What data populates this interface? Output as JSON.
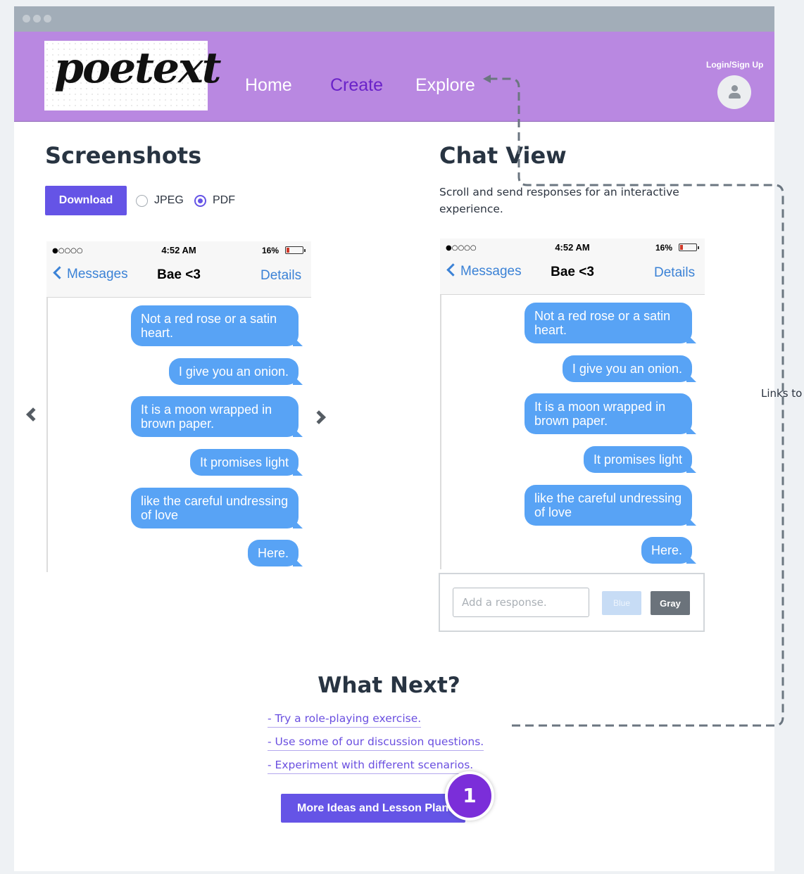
{
  "nav": {
    "logo_text": "poetext",
    "links": [
      "Home",
      "Create",
      "Explore"
    ],
    "active_link": "Create",
    "login_label": "Login/Sign Up"
  },
  "screenshots": {
    "title": "Screenshots",
    "download_label": "Download",
    "formats": [
      {
        "label": "JPEG",
        "selected": false
      },
      {
        "label": "PDF",
        "selected": true
      }
    ]
  },
  "phone": {
    "signal": "●○○○○",
    "time": "4:52 AM",
    "battery": "16%",
    "back_label": "Messages",
    "contact": "Bae <3",
    "details_label": "Details",
    "messages": [
      "Not a red rose or a satin heart.",
      "I give you an onion.",
      "It is a moon wrapped in brown paper.",
      "It promises light",
      "like the careful undressing of love",
      "Here."
    ]
  },
  "chat_view": {
    "title": "Chat View",
    "subtitle": "Scroll and send responses for an interactive experience.",
    "response_placeholder": "Add a response.",
    "blue_label": "Blue",
    "gray_label": "Gray"
  },
  "what_next": {
    "title": "What Next?",
    "links": [
      "- Try a role-playing exercise.",
      "- Use some of our discussion questions.",
      "- Experiment with different scenarios."
    ],
    "lesson_button": "More Ideas and Lesson Plans",
    "badge": "1"
  },
  "annotation": {
    "note": "Links to"
  },
  "colors": {
    "navbar": "#b988e1",
    "active_link": "#6a22c9",
    "primary_button": "#6554e6",
    "bubble": "#58a3f5",
    "badge": "#7b2ed9"
  }
}
